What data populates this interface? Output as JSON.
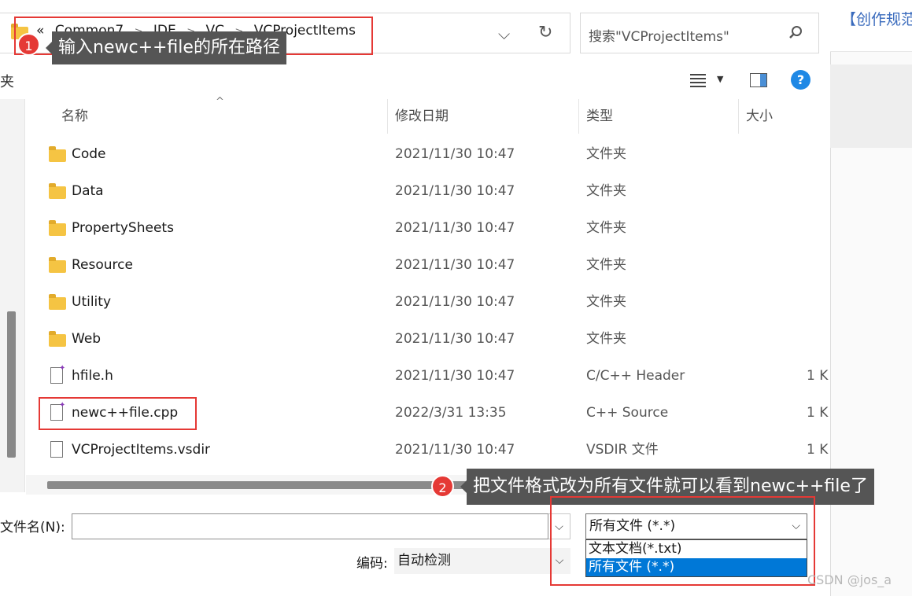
{
  "address": {
    "crumbs": [
      "«",
      "Common7",
      "IDE",
      "VC",
      "VCProjectItems"
    ],
    "chevron": "⌵",
    "refresh": "↻"
  },
  "search": {
    "placeholder": "搜索\"VCProjectItems\""
  },
  "toolbar": {
    "left_fragment": "夹",
    "help": "?"
  },
  "columns": {
    "name": "名称",
    "date": "修改日期",
    "type": "类型",
    "size": "大小"
  },
  "rows": [
    {
      "icon": "folder-icon",
      "name": "Code",
      "date": "2021/11/30 10:47",
      "type": "文件夹",
      "size": ""
    },
    {
      "icon": "folder-icon",
      "name": "Data",
      "date": "2021/11/30 10:47",
      "type": "文件夹",
      "size": ""
    },
    {
      "icon": "folder-icon",
      "name": "PropertySheets",
      "date": "2021/11/30 10:47",
      "type": "文件夹",
      "size": ""
    },
    {
      "icon": "folder-icon",
      "name": "Resource",
      "date": "2021/11/30 10:47",
      "type": "文件夹",
      "size": ""
    },
    {
      "icon": "folder-icon",
      "name": "Utility",
      "date": "2021/11/30 10:47",
      "type": "文件夹",
      "size": ""
    },
    {
      "icon": "folder-icon",
      "name": "Web",
      "date": "2021/11/30 10:47",
      "type": "文件夹",
      "size": ""
    },
    {
      "icon": "header-file-icon",
      "name": "hfile.h",
      "date": "2021/11/30 10:47",
      "type": "C/C++ Header",
      "size": "1 K"
    },
    {
      "icon": "cpp-file-icon",
      "name": "newc++file.cpp",
      "date": "2022/3/31 13:35",
      "type": "C++ Source",
      "size": "1 K"
    },
    {
      "icon": "file-icon",
      "name": "VCProjectItems.vsdir",
      "date": "2021/11/30 10:47",
      "type": "VSDIR 文件",
      "size": "1 K"
    }
  ],
  "bottom": {
    "filename_label": "文件名(N):",
    "filename_value": "",
    "encoding_label": "编码:",
    "encoding_value": "自动检测",
    "filter_selected": "所有文件 (*.*)",
    "filter_options": [
      "文本文档(*.txt)",
      "所有文件 (*.*)"
    ]
  },
  "background_page": {
    "title": "【创作规范",
    "watermark": "CSDN @jos_a"
  },
  "annotations": {
    "step1": {
      "badge": "1",
      "text": "输入newc++file的所在路径"
    },
    "step2": {
      "badge": "2",
      "text": "把文件格式改为所有文件就可以看到newc++file了"
    }
  },
  "colors": {
    "accent": "#0078d7",
    "annotation_red": "#e53935",
    "tip_bg": "#555555",
    "folder": "#f5c443"
  }
}
